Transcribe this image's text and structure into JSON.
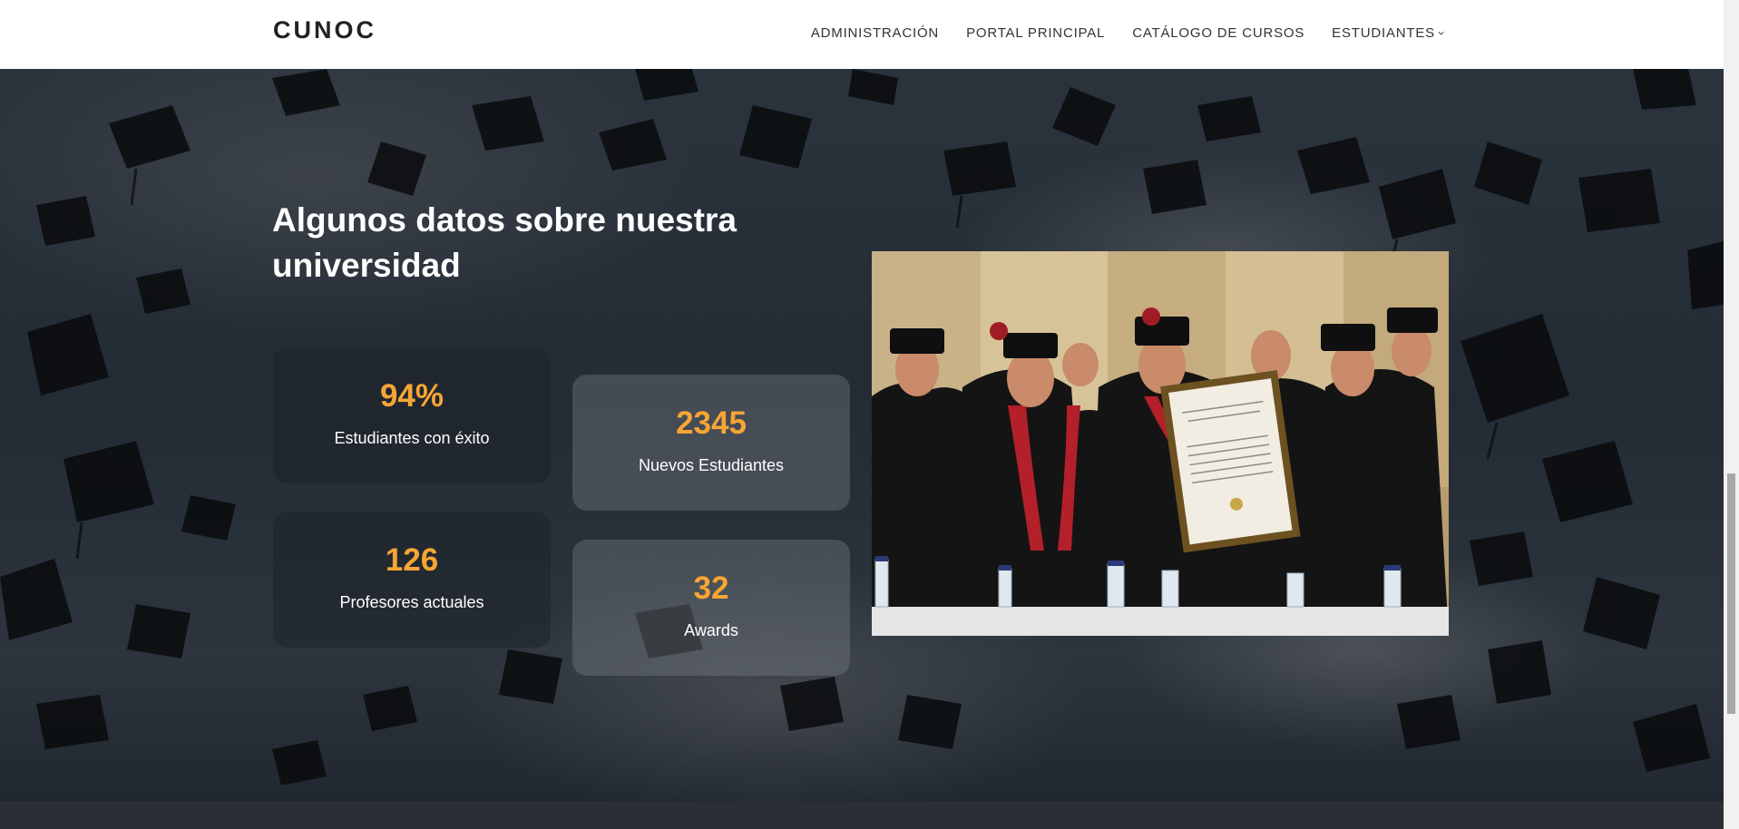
{
  "navbar": {
    "brand": "CUNOC",
    "links": [
      {
        "label": "ADMINISTRACIÓN"
      },
      {
        "label": "PORTAL PRINCIPAL"
      },
      {
        "label": "CATÁLOGO DE CURSOS"
      },
      {
        "label": "ESTUDIANTES",
        "has_dropdown": true
      }
    ]
  },
  "facts": {
    "heading": "Algunos datos sobre nuestra universidad",
    "stats": [
      {
        "value": "94%",
        "label": "Estudiantes con éxito"
      },
      {
        "value": "2345",
        "label": "Nuevos Estudiantes"
      },
      {
        "value": "126",
        "label": "Profesores actuales"
      },
      {
        "value": "32",
        "label": "Awards"
      }
    ],
    "photo": {
      "icon": "graduation-ceremony-photo"
    }
  },
  "colors": {
    "accent": "#f7a534",
    "navbar_bg": "#ffffff",
    "text_light": "#ffffff"
  }
}
